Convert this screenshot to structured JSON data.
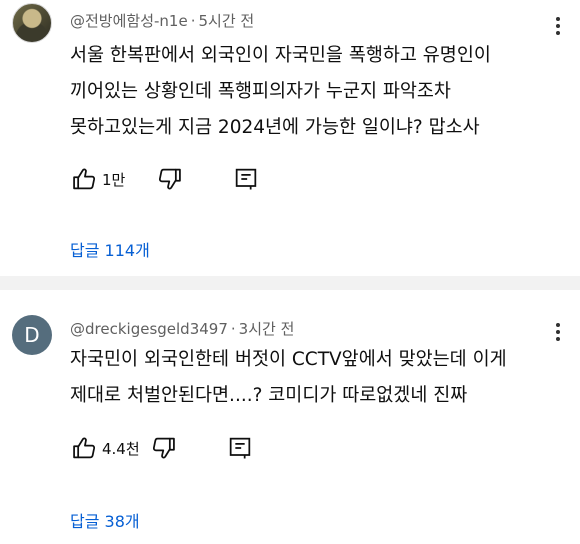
{
  "comments": [
    {
      "handle": "@전방에함성-n1e",
      "time": "5시간 전",
      "lines": [
        "서울 한복판에서 외국인이 자국민을 폭행하고 유명인이",
        "끼어있는 상황인데 폭행피의자가 누군지 파악조차",
        "못하고있는게 지금 2024년에 가능한 일이냐?  맙소사"
      ],
      "likes": "1만",
      "replies_label": "답글 114개"
    },
    {
      "avatar_letter": "D",
      "avatar_color": "#556d7d",
      "handle": "@dreckigesgeld3497",
      "time": "3시간 전",
      "lines": [
        "자국민이 외국인한테 버젓이 CCTV앞에서 맞았는데 이게",
        "제대로 처벌안된다면....? 코미디가 따로없겠네 진짜"
      ],
      "likes": "4.4천",
      "replies_label": "답글 38개"
    }
  ],
  "icons": {
    "like": "thumbs-up-icon",
    "dislike": "thumbs-down-icon",
    "reply": "reply-icon",
    "more": "more-vert-icon"
  },
  "colors": {
    "link": "#065fd4",
    "meta": "#606060",
    "text": "#0f0f0f"
  }
}
